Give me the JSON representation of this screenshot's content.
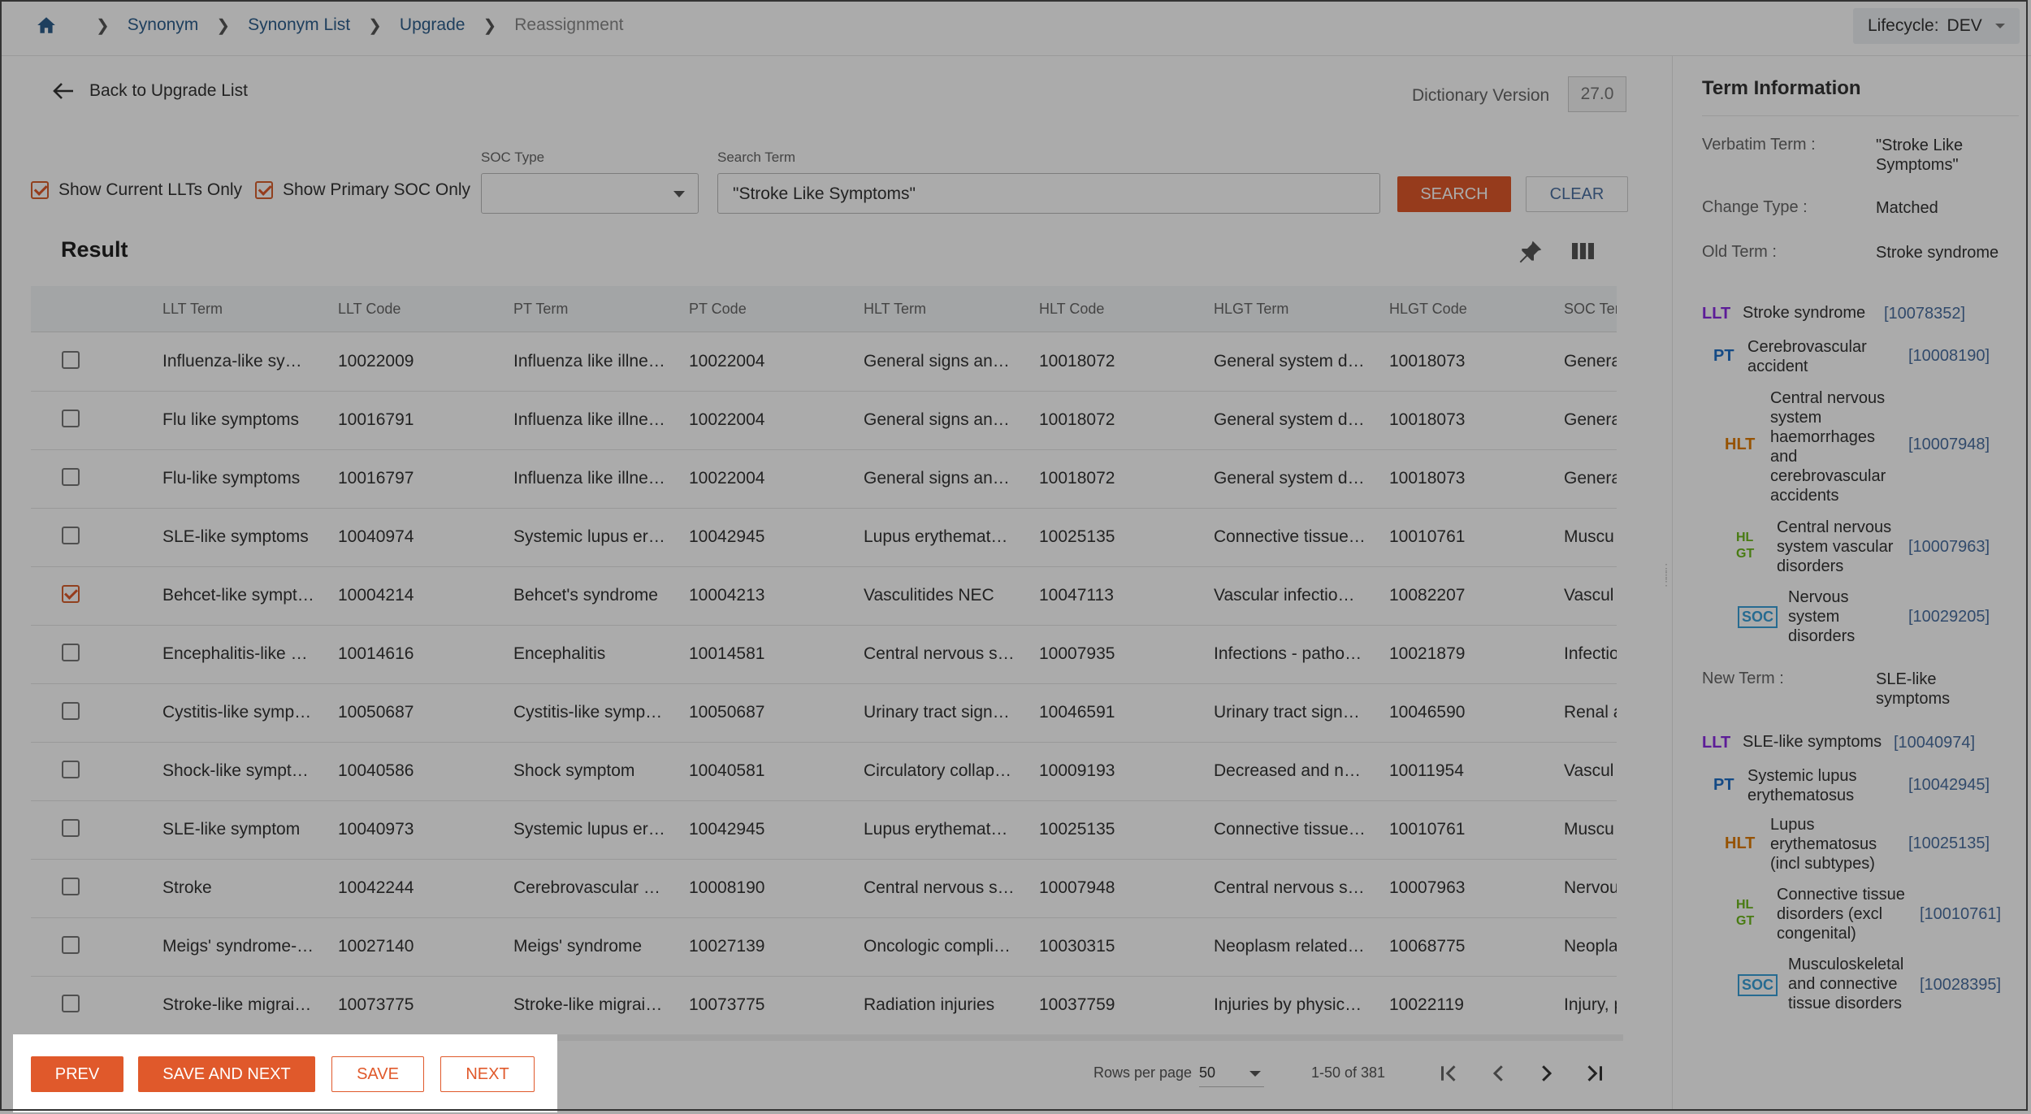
{
  "breadcrumb": {
    "items": [
      "Synonym",
      "Synonym List",
      "Upgrade"
    ],
    "current": "Reassignment"
  },
  "lifecycle": {
    "label": "Lifecycle:",
    "value": "DEV"
  },
  "back": {
    "label": "Back to Upgrade List"
  },
  "dictionary": {
    "label": "Dictionary Version",
    "value": "27.0"
  },
  "filters": {
    "current_llts": "Show Current LLTs Only",
    "primary_soc": "Show Primary SOC Only",
    "soc_type_label": "SOC Type",
    "soc_type_value": "",
    "search_label": "Search Term",
    "search_value": "\"Stroke Like Symptoms\"",
    "search_button": "SEARCH",
    "clear_button": "CLEAR"
  },
  "result": {
    "title": "Result"
  },
  "table": {
    "headers": [
      "LLT Term",
      "LLT Code",
      "PT Term",
      "PT Code",
      "HLT Term",
      "HLT Code",
      "HLGT Term",
      "HLGT Code",
      "SOC Ter"
    ],
    "rows": [
      {
        "checked": false,
        "cells": [
          "Influenza-like sy…",
          "10022009",
          "Influenza like illne…",
          "10022004",
          "General signs an…",
          "10018072",
          "General system d…",
          "10018073",
          "Genera"
        ]
      },
      {
        "checked": false,
        "cells": [
          "Flu like symptoms",
          "10016791",
          "Influenza like illne…",
          "10022004",
          "General signs an…",
          "10018072",
          "General system d…",
          "10018073",
          "Genera"
        ]
      },
      {
        "checked": false,
        "cells": [
          "Flu-like symptoms",
          "10016797",
          "Influenza like illne…",
          "10022004",
          "General signs an…",
          "10018072",
          "General system d…",
          "10018073",
          "Genera"
        ]
      },
      {
        "checked": false,
        "cells": [
          "SLE-like symptoms",
          "10040974",
          "Systemic lupus er…",
          "10042945",
          "Lupus erythemat…",
          "10025135",
          "Connective tissue…",
          "10010761",
          "Muscu"
        ]
      },
      {
        "checked": true,
        "cells": [
          "Behcet-like sympt…",
          "10004214",
          "Behcet's syndrome",
          "10004213",
          "Vasculitides NEC",
          "10047113",
          "Vascular infectio…",
          "10082207",
          "Vascul"
        ]
      },
      {
        "checked": false,
        "cells": [
          "Encephalitis-like …",
          "10014616",
          "Encephalitis",
          "10014581",
          "Central nervous s…",
          "10007935",
          "Infections - patho…",
          "10021879",
          "Infectio"
        ]
      },
      {
        "checked": false,
        "cells": [
          "Cystitis-like symp…",
          "10050687",
          "Cystitis-like symp…",
          "10050687",
          "Urinary tract sign…",
          "10046591",
          "Urinary tract sign…",
          "10046590",
          "Renal a"
        ]
      },
      {
        "checked": false,
        "cells": [
          "Shock-like sympt…",
          "10040586",
          "Shock symptom",
          "10040581",
          "Circulatory collap…",
          "10009193",
          "Decreased and n…",
          "10011954",
          "Vascul"
        ]
      },
      {
        "checked": false,
        "cells": [
          "SLE-like symptom",
          "10040973",
          "Systemic lupus er…",
          "10042945",
          "Lupus erythemat…",
          "10025135",
          "Connective tissue…",
          "10010761",
          "Muscu"
        ]
      },
      {
        "checked": false,
        "cells": [
          "Stroke",
          "10042244",
          "Cerebrovascular …",
          "10008190",
          "Central nervous s…",
          "10007948",
          "Central nervous s…",
          "10007963",
          "Nervou"
        ]
      },
      {
        "checked": false,
        "cells": [
          "Meigs' syndrome-…",
          "10027140",
          "Meigs' syndrome",
          "10027139",
          "Oncologic compli…",
          "10030315",
          "Neoplasm related…",
          "10068775",
          "Neopla"
        ]
      },
      {
        "checked": false,
        "cells": [
          "Stroke-like migrai…",
          "10073775",
          "Stroke-like migrai…",
          "10073775",
          "Radiation injuries",
          "10037759",
          "Injuries by physic…",
          "10022119",
          "Injury, p"
        ]
      }
    ]
  },
  "footer": {
    "prev": "PREV",
    "save_next": "SAVE AND NEXT",
    "save": "SAVE",
    "next": "NEXT",
    "rows_per_page_label": "Rows per page",
    "rows_per_page": "50",
    "range": "1-50 of 381"
  },
  "term_info": {
    "title": "Term Information",
    "verbatim_label": "Verbatim Term :",
    "verbatim_value": "\"Stroke Like Symptoms\"",
    "change_type_label": "Change Type :",
    "change_type_value": "Matched",
    "old_term_label": "Old Term :",
    "old_term_value": "Stroke syndrome",
    "new_term_label": "New Term :",
    "new_term_value": "SLE-like symptoms",
    "tags": {
      "llt": "LLT",
      "pt": "PT",
      "hlt": "HLT",
      "hlgt_top": "HL",
      "hlgt_bottom": "GT",
      "soc": "SOC"
    },
    "old_hierarchy": {
      "llt_name": "Stroke syndrome",
      "llt_code": "[10078352]",
      "pt_name": "Cerebrovascular accident",
      "pt_code": "[10008190]",
      "hlt_name": "Central nervous system haemorrhages and cerebrovascular accidents",
      "hlt_code": "[10007948]",
      "hlgt_name": "Central nervous system vascular disorders",
      "hlgt_code": "[10007963]",
      "soc_name": "Nervous system disorders",
      "soc_code": "[10029205]"
    },
    "new_hierarchy": {
      "llt_name": "SLE-like symptoms",
      "llt_code": "[10040974]",
      "pt_name": "Systemic lupus erythematosus",
      "pt_code": "[10042945]",
      "hlt_name": "Lupus erythematosus (incl subtypes)",
      "hlt_code": "[10025135]",
      "hlgt_name": "Connective tissue disorders (excl congenital)",
      "hlgt_code": "[10010761]",
      "soc_name": "Musculoskeletal and connective tissue disorders",
      "soc_code": "[10028395]"
    }
  },
  "colors": {
    "accent": "#e0592b",
    "llt": "#8a2be2",
    "pt": "#1e6fc7",
    "hlt": "#e07b00",
    "hlgt": "#6cb81b",
    "soc": "#3aa0d8"
  }
}
